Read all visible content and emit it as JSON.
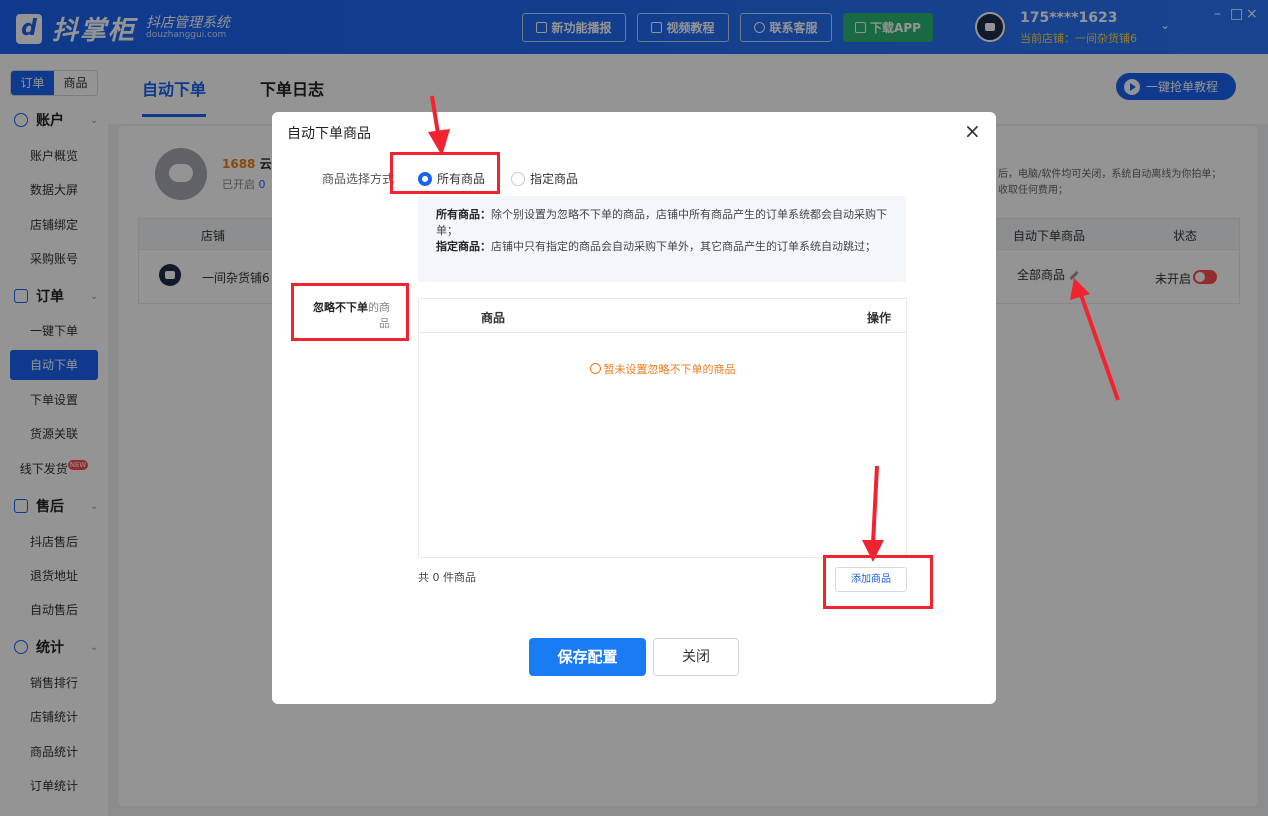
{
  "app": {
    "logo_text": "抖掌柜",
    "logo_sub_cn": "抖店管理系统",
    "logo_sub_en": "douzhanggui.com"
  },
  "topbar": {
    "buttons": [
      "新功能播报",
      "视频教程",
      "联系客服",
      "下载APP"
    ],
    "user_phone": "175****1623",
    "user_store": "当前店铺：一间杂货铺6",
    "window_controls": [
      "–",
      "□",
      "×"
    ]
  },
  "sidebar": {
    "segment": [
      "订单",
      "商品"
    ],
    "groups": {
      "account": "账户",
      "order": "订单",
      "aftersale": "售后",
      "stats": "统计"
    },
    "account_items": [
      "账户概览",
      "数据大屏",
      "店铺绑定",
      "采购账号"
    ],
    "order_items": [
      "一键下单",
      "自动下单",
      "下单设置",
      "货源关联",
      "线下发货"
    ],
    "aftersale_items": [
      "抖店售后",
      "退货地址",
      "自动售后"
    ],
    "stats_items": [
      "销售排行",
      "店铺统计",
      "商品统计",
      "订单统计"
    ],
    "new_badge": "NEW"
  },
  "main": {
    "tabs": [
      "自动下单",
      "下单日志"
    ],
    "tutorial_button": "一键抢单教程",
    "cloud_title_prefix": "1688",
    "cloud_title_bold": "云下",
    "cloud_sub_prefix": "已开启",
    "cloud_sub_count": "0",
    "notice_line1": "后，电脑/软件均可关闭，系统自动离线为你拍单；",
    "notice_line2": "收取任何费用；",
    "table_headers": [
      "店铺",
      "自动下单商品",
      "状态"
    ],
    "row": {
      "store": "一间杂货铺6",
      "goods": "全部商品",
      "status": "未开启"
    }
  },
  "modal": {
    "title": "自动下单商品",
    "close": "×",
    "method_label": "商品选择方式",
    "radio_all": "所有商品",
    "radio_specified": "指定商品",
    "desc_all_label": "所有商品：",
    "desc_all_text": "除个别设置为忽略不下单的商品，店铺中所有商品产生的订单系统都会自动采购下单；",
    "desc_spec_label": "指定商品：",
    "desc_spec_text": "店铺中只有指定的商品会自动采购下单外，其它商品产生的订单系统自动跳过；",
    "ignore_label_bold": "忽略不下单",
    "ignore_label_rest": "的商品",
    "col_goods": "商品",
    "col_action": "操作",
    "empty_tip": "暂未设置忽略不下单的商品",
    "total": "共 0 件商品",
    "add_button": "添加商品",
    "save_button": "保存配置",
    "close_button": "关闭"
  },
  "colors": {
    "primary": "#1a63f2",
    "annotation_red": "#f0232f",
    "warn_orange": "#f07b1d"
  }
}
